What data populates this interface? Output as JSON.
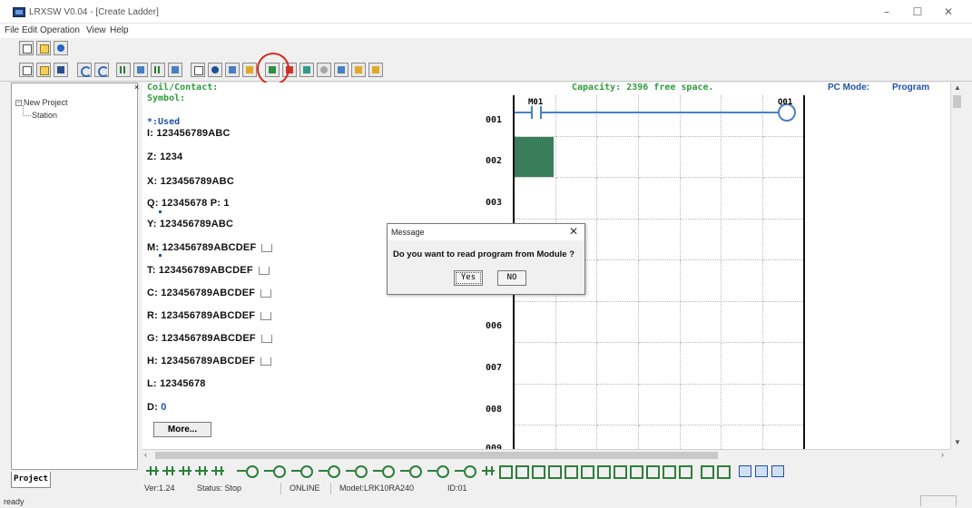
{
  "window": {
    "title": "LRXSW V0.04 - [Create Ladder]",
    "minimize_glyph": "–",
    "maximize_glyph": "☐",
    "close_glyph": "✕"
  },
  "menu": [
    "File",
    "Edit",
    "Operation",
    "View",
    "Help"
  ],
  "toolbar_top": [
    "new-document-icon",
    "open-folder-icon",
    "help-icon"
  ],
  "toolbar_main": [
    "new-file-icon",
    "open-file-icon",
    "save-icon",
    "undo-icon",
    "redo-icon",
    "ladder-icon",
    "grid-icon",
    "function-block-icon",
    "monitor-icon",
    "settings-icon",
    "gear-icon",
    "write-icon",
    "read-from-module-icon",
    "write-to-module-icon",
    "teal-run-icon",
    "grey-stop-icon",
    "chart-icon",
    "info-icon",
    "lock-icon"
  ],
  "tree": {
    "root": "New Project",
    "child": "Station",
    "tab_label": "Project"
  },
  "left_labels": {
    "coil_contact": "Coil/Contact:",
    "symbol": "Symbol:",
    "used": "*:Used"
  },
  "device_list": [
    {
      "prefix": "I:",
      "value": "123456789ABC",
      "has_button": false
    },
    {
      "prefix": "Z:",
      "value": "1234",
      "has_button": false
    },
    {
      "prefix": "X:",
      "value": "123456789ABC",
      "has_button": false
    },
    {
      "prefix": "Q:",
      "value": "12345678  P: 1",
      "has_button": false
    },
    {
      "prefix": "Y:",
      "value": "123456789ABC",
      "has_button": false
    },
    {
      "prefix": "M:",
      "value": "123456789ABCDEF",
      "has_button": true
    },
    {
      "prefix": "T:",
      "value": "123456789ABCDEF",
      "has_button": true
    },
    {
      "prefix": "C:",
      "value": "123456789ABCDEF",
      "has_button": true
    },
    {
      "prefix": "R:",
      "value": "123456789ABCDEF",
      "has_button": true
    },
    {
      "prefix": "G:",
      "value": "123456789ABCDEF",
      "has_button": true
    },
    {
      "prefix": "H:",
      "value": "123456789ABCDEF",
      "has_button": true
    },
    {
      "prefix": "L:",
      "value": "12345678",
      "has_button": false
    },
    {
      "prefix": "D:",
      "value": "0",
      "has_button": false
    }
  ],
  "more_button": "More...",
  "capacity": "Capacity:  2396 free space.",
  "pc_mode": {
    "label": "PC Mode:",
    "value": "Program"
  },
  "rows": [
    "001",
    "002",
    "003",
    "006",
    "007",
    "008",
    "009"
  ],
  "ladder": {
    "contact": "M01",
    "coil": "Q01"
  },
  "dialog": {
    "title": "Message",
    "message": "Do you want to read program from Module ?",
    "yes": "Yes",
    "no": "NO",
    "close_glyph": "✕"
  },
  "status": {
    "version": "Ver:1.24",
    "status": "Status: Stop",
    "online": "ONLINE",
    "model": "Model:LRK10RA240",
    "id": "ID:01"
  },
  "ready_text": "ready",
  "colors": {
    "green_label": "#2e9d3b",
    "blue_value": "#2052a8",
    "highlight_circle": "#d9261c",
    "selected_cell": "#3a7d5a",
    "rung_line": "#4a7fc8"
  }
}
